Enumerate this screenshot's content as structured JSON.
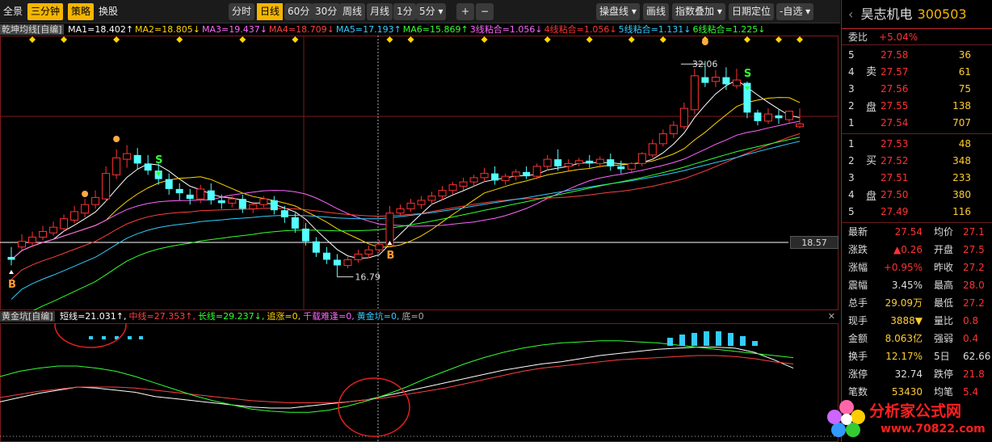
{
  "toolbar": {
    "left_items": [
      "全景",
      "三分钟",
      "策略",
      "换股"
    ],
    "periods": [
      "分时",
      "日线",
      "60分",
      "30分",
      "周线",
      "月线",
      "1分",
      "5分 ▾"
    ],
    "selected_period": "日线",
    "zoom_plus": "+",
    "zoom_minus": "−",
    "right_items": [
      "操盘线 ▾",
      "画线",
      "指数叠加 ▾",
      "日期定位",
      "-自选 ▾"
    ]
  },
  "ma_header": {
    "indicator_name": "乾坤均线[自编]",
    "items": [
      {
        "text": "MA1=18.402",
        "arrow": "↑",
        "color": "#ffffff"
      },
      {
        "text": "MA2=18.805",
        "arrow": "↓",
        "color": "#ffd700"
      },
      {
        "text": "MA3=19.437",
        "arrow": "↓",
        "color": "#ff66ff"
      },
      {
        "text": "MA4=18.709",
        "arrow": "↓",
        "color": "#ff4040"
      },
      {
        "text": "MA5=17.193",
        "arrow": "↑",
        "color": "#33ccff"
      },
      {
        "text": "MA6=15.869",
        "arrow": "↑",
        "color": "#33ff33"
      },
      {
        "text": "3线粘合=1.056",
        "arrow": "↓",
        "color": "#ff66ff"
      },
      {
        "text": "4线粘合=1.056",
        "arrow": "↓",
        "color": "#ff3333"
      },
      {
        "text": "5线粘合=1.131",
        "arrow": "↓",
        "color": "#33ccff"
      },
      {
        "text": "6线粘合=1.225",
        "arrow": "↓",
        "color": "#33ff33"
      }
    ]
  },
  "chart_labels": {
    "high_label": "32.06",
    "low_label": "16.79",
    "price_line_label": "18.57",
    "buy_signal": "B",
    "sell_signal": "S"
  },
  "indicator_header": {
    "name": "黄金坑[自编]",
    "items": [
      {
        "text": "短线=21.031",
        "arrow": "↑",
        "color": "#ffffff"
      },
      {
        "text": "中线=27.353",
        "arrow": "↑",
        "color": "#ff4040"
      },
      {
        "text": "长线=29.237",
        "arrow": "↓",
        "color": "#33ff33"
      },
      {
        "text": "追涨=0",
        "arrow": "",
        "color": "#ffd700"
      },
      {
        "text": "千载难逢=0",
        "arrow": "",
        "color": "#ff66ff"
      },
      {
        "text": "黄金坑=0",
        "arrow": "",
        "color": "#33ccff"
      },
      {
        "text": "底=0",
        "arrow": "",
        "color": "#aaaaaa"
      }
    ]
  },
  "side": {
    "stock_name": "昊志机电",
    "stock_code": "300503",
    "weibi_label": "委比",
    "weibi_value": "+5.04%",
    "sell_tag": [
      "卖",
      "盘"
    ],
    "buy_tag": [
      "买",
      "盘"
    ],
    "sell_book": [
      {
        "level": "5",
        "price": "27.58",
        "vol": "36"
      },
      {
        "level": "4",
        "price": "27.57",
        "vol": "61"
      },
      {
        "level": "3",
        "price": "27.56",
        "vol": "75"
      },
      {
        "level": "2",
        "price": "27.55",
        "vol": "138"
      },
      {
        "level": "1",
        "price": "27.54",
        "vol": "707"
      }
    ],
    "buy_book": [
      {
        "level": "1",
        "price": "27.53",
        "vol": "48"
      },
      {
        "level": "2",
        "price": "27.52",
        "vol": "348"
      },
      {
        "level": "3",
        "price": "27.51",
        "vol": "233"
      },
      {
        "level": "4",
        "price": "27.50",
        "vol": "380"
      },
      {
        "level": "5",
        "price": "27.49",
        "vol": "116"
      }
    ],
    "stats": [
      {
        "k": "最新",
        "v": "27.54",
        "k2": "均价",
        "v2": "27.1"
      },
      {
        "k": "涨跌",
        "v": "▲0.26",
        "k2": "开盘",
        "v2": "27.5"
      },
      {
        "k": "涨幅",
        "v": "+0.95%",
        "k2": "昨收",
        "v2": "27.2"
      },
      {
        "k": "震幅",
        "v": "3.45%",
        "k2": "最高",
        "v2": "28.0"
      },
      {
        "k": "总手",
        "v": "29.09万",
        "k2": "最低",
        "v2": "27.2"
      },
      {
        "k": "现手",
        "v": "3888▼",
        "k2": "量比",
        "v2": "0.8"
      },
      {
        "k": "金额",
        "v": "8.063亿",
        "k2": "强弱",
        "v2": "0.4"
      },
      {
        "k": "换手",
        "v": "12.17%",
        "k2": "5日",
        "v2": "62.66"
      },
      {
        "k": "涨停",
        "v": "32.74",
        "k2": "跌停",
        "v2": "21.8"
      },
      {
        "k": "笔数",
        "v": "53430",
        "k2": "均笔",
        "v2": "5.4"
      }
    ]
  },
  "watermark": {
    "name": "分析家公式网",
    "url": "www.70822.com"
  },
  "chart_data": {
    "type": "candlestick",
    "ohlc": [
      [
        18.2,
        18.9,
        18.0,
        17.6
      ],
      [
        18.9,
        19.8,
        19.3,
        18.7
      ],
      [
        19.2,
        20.0,
        19.6,
        18.9
      ],
      [
        19.6,
        20.4,
        20.0,
        19.4
      ],
      [
        19.9,
        20.7,
        20.3,
        19.7
      ],
      [
        20.2,
        21.2,
        20.9,
        20.0
      ],
      [
        20.8,
        21.8,
        21.4,
        20.6
      ],
      [
        21.3,
        22.3,
        21.9,
        21.0
      ],
      [
        21.9,
        22.9,
        22.4,
        21.6
      ],
      [
        22.3,
        24.6,
        24.1,
        22.1
      ],
      [
        24.0,
        25.8,
        25.2,
        23.7
      ],
      [
        25.1,
        26.1,
        25.5,
        24.5
      ],
      [
        25.4,
        25.9,
        24.8,
        24.4
      ],
      [
        24.8,
        25.4,
        24.3,
        24.0
      ],
      [
        24.3,
        24.8,
        23.7,
        23.3
      ],
      [
        23.7,
        24.1,
        23.0,
        22.6
      ],
      [
        23.0,
        23.4,
        22.7,
        22.2
      ],
      [
        22.6,
        23.0,
        22.3,
        21.9
      ],
      [
        22.3,
        23.3,
        23.0,
        22.0
      ],
      [
        22.9,
        23.4,
        22.2,
        21.9
      ],
      [
        22.2,
        22.6,
        22.0,
        21.6
      ],
      [
        22.0,
        22.5,
        22.3,
        21.7
      ],
      [
        22.3,
        22.6,
        21.6,
        21.3
      ],
      [
        21.6,
        22.1,
        21.9,
        21.3
      ],
      [
        21.9,
        22.5,
        22.3,
        21.7
      ],
      [
        22.2,
        22.5,
        21.5,
        21.2
      ],
      [
        21.5,
        21.8,
        21.0,
        20.6
      ],
      [
        21.0,
        21.3,
        20.2,
        19.9
      ],
      [
        20.2,
        20.6,
        19.3,
        19.0
      ],
      [
        19.3,
        19.6,
        18.5,
        18.2
      ],
      [
        18.5,
        18.9,
        18.0,
        17.7
      ],
      [
        18.0,
        18.4,
        17.6,
        16.79
      ],
      [
        17.6,
        18.2,
        18.0,
        17.4
      ],
      [
        18.0,
        18.7,
        18.4,
        17.8
      ],
      [
        18.4,
        19.0,
        18.7,
        18.1
      ],
      [
        18.7,
        19.4,
        19.1,
        18.5
      ],
      [
        19.0,
        21.8,
        21.3,
        18.9
      ],
      [
        21.3,
        21.9,
        21.6,
        21.1
      ],
      [
        21.6,
        22.3,
        22.0,
        21.4
      ],
      [
        21.9,
        22.5,
        22.2,
        21.6
      ],
      [
        22.2,
        22.8,
        22.5,
        21.9
      ],
      [
        22.5,
        23.2,
        22.9,
        22.2
      ],
      [
        22.9,
        23.5,
        23.3,
        22.6
      ],
      [
        23.2,
        23.8,
        23.5,
        22.9
      ],
      [
        23.5,
        24.0,
        23.8,
        23.2
      ],
      [
        23.8,
        24.5,
        24.1,
        23.5
      ],
      [
        24.1,
        24.6,
        23.6,
        23.3
      ],
      [
        23.6,
        24.1,
        23.9,
        23.3
      ],
      [
        23.9,
        24.4,
        24.2,
        23.6
      ],
      [
        24.2,
        24.6,
        23.9,
        23.7
      ],
      [
        23.9,
        24.8,
        24.6,
        23.7
      ],
      [
        24.6,
        25.4,
        25.1,
        24.3
      ],
      [
        25.1,
        25.8,
        24.6,
        24.3
      ],
      [
        24.6,
        25.1,
        24.8,
        24.3
      ],
      [
        24.8,
        25.2,
        25.0,
        24.6
      ],
      [
        25.0,
        25.4,
        24.8,
        24.5
      ],
      [
        24.8,
        25.3,
        25.1,
        24.5
      ],
      [
        25.1,
        25.5,
        24.6,
        24.3
      ],
      [
        24.6,
        25.0,
        24.4,
        24.1
      ],
      [
        24.4,
        24.9,
        24.8,
        24.2
      ],
      [
        24.8,
        25.6,
        25.5,
        24.6
      ],
      [
        25.4,
        26.5,
        26.2,
        25.2
      ],
      [
        26.2,
        27.2,
        26.9,
        26.0
      ],
      [
        26.9,
        27.8,
        27.5,
        26.6
      ],
      [
        27.4,
        29.1,
        28.7,
        27.2
      ],
      [
        28.6,
        31.5,
        31.0,
        28.3
      ],
      [
        30.9,
        32.06,
        30.5,
        30.2
      ],
      [
        30.6,
        31.4,
        30.9,
        30.2
      ],
      [
        30.9,
        31.6,
        30.4,
        30.0
      ],
      [
        30.3,
        31.5,
        30.7,
        30.1
      ],
      [
        30.5,
        30.6,
        28.4,
        28.0
      ],
      [
        28.4,
        28.6,
        27.8,
        27.5
      ],
      [
        27.8,
        28.7,
        28.3,
        27.6
      ],
      [
        28.2,
        28.6,
        28.0,
        27.6
      ],
      [
        27.9,
        28.5,
        28.5,
        27.7
      ],
      [
        27.4,
        28.7,
        27.6,
        27.3
      ]
    ],
    "y_range": [
      15.0,
      33.5
    ],
    "indicator_lines": {
      "short": [
        16,
        20,
        24,
        27,
        30,
        29,
        27,
        25,
        21,
        19,
        17,
        15,
        13,
        11,
        10,
        10,
        12,
        14,
        16,
        18,
        22,
        26,
        30,
        34,
        38,
        42,
        46,
        49,
        52,
        54,
        57,
        60,
        62,
        64,
        66,
        67,
        68,
        68,
        67,
        63,
        56,
        48
      ],
      "mid": [
        20,
        23,
        26,
        28,
        30,
        30,
        30,
        29,
        27,
        25,
        23,
        21,
        19,
        17,
        16,
        15,
        15,
        15,
        16,
        18,
        20,
        23,
        26,
        29,
        33,
        37,
        41,
        45,
        48,
        50,
        52,
        54,
        56,
        57,
        58,
        59,
        60,
        60,
        59,
        57,
        54,
        52
      ],
      "long": [
        40,
        45,
        48,
        50,
        50,
        48,
        45,
        40,
        34,
        28,
        22,
        17,
        13,
        9,
        7,
        6,
        6,
        8,
        12,
        17,
        23,
        30,
        38,
        45,
        52,
        58,
        63,
        67,
        70,
        72,
        73,
        74,
        74,
        73,
        72,
        70,
        68,
        66,
        64,
        62,
        60,
        58
      ]
    }
  }
}
